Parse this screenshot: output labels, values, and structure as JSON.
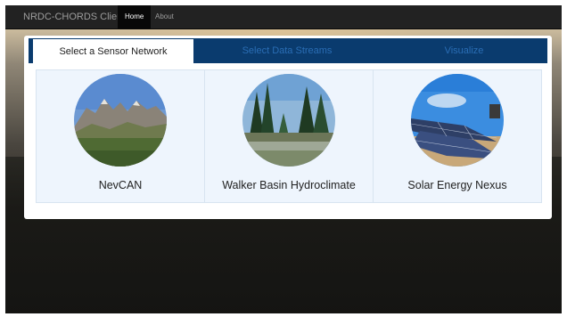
{
  "navbar": {
    "brand": "NRDC-CHORDS Client",
    "links": [
      {
        "label": "Home",
        "active": true
      },
      {
        "label": "About",
        "active": false
      }
    ]
  },
  "tabs": [
    {
      "label": "Select a Sensor Network",
      "active": true
    },
    {
      "label": "Select Data Streams",
      "active": false
    },
    {
      "label": "Visualize",
      "active": false
    }
  ],
  "networks": [
    {
      "name": "NevCAN",
      "image": "mountain-landscape-image"
    },
    {
      "name": "Walker Basin Hydroclimate",
      "image": "forest-stream-image"
    },
    {
      "name": "Solar Energy Nexus",
      "image": "solar-panels-image"
    }
  ],
  "colors": {
    "navbar": "#222222",
    "tabbar": "#0a3b6e",
    "tab_inactive_text": "#2a6db4",
    "card_bg": "#eef5fd"
  }
}
